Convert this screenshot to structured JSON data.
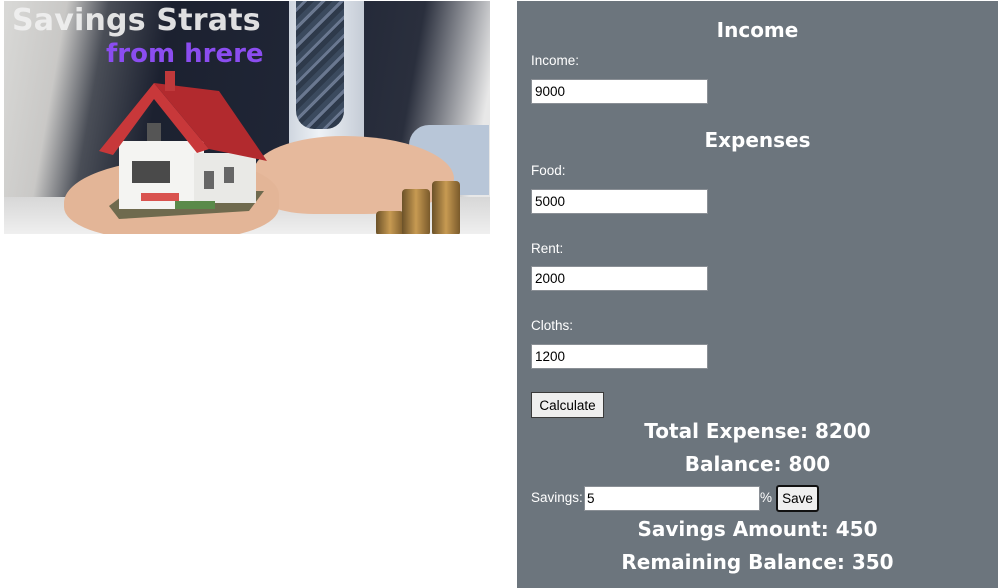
{
  "hero": {
    "title_line1": "Savings Strats",
    "title_line2": "from hrere"
  },
  "income_section": {
    "heading": "Income",
    "income_label": "Income:",
    "income_value": "9000"
  },
  "expenses_section": {
    "heading": "Expenses",
    "food_label": "Food:",
    "food_value": "5000",
    "rent_label": "Rent:",
    "rent_value": "2000",
    "cloths_label": "Cloths:",
    "cloths_value": "1200"
  },
  "calculate_button": "Calculate",
  "results": {
    "total_expense": "Total Expense: 8200",
    "balance": "Balance: 800"
  },
  "savings": {
    "label": "Savings:",
    "value": "5",
    "percent_sign": "%",
    "save_button": "Save"
  },
  "savings_results": {
    "savings_amount": "Savings Amount: 450",
    "remaining_balance": "Remaining Balance: 350"
  },
  "colors": {
    "panel_bg": "#6c757d",
    "accent_purple": "#8b4df0"
  }
}
